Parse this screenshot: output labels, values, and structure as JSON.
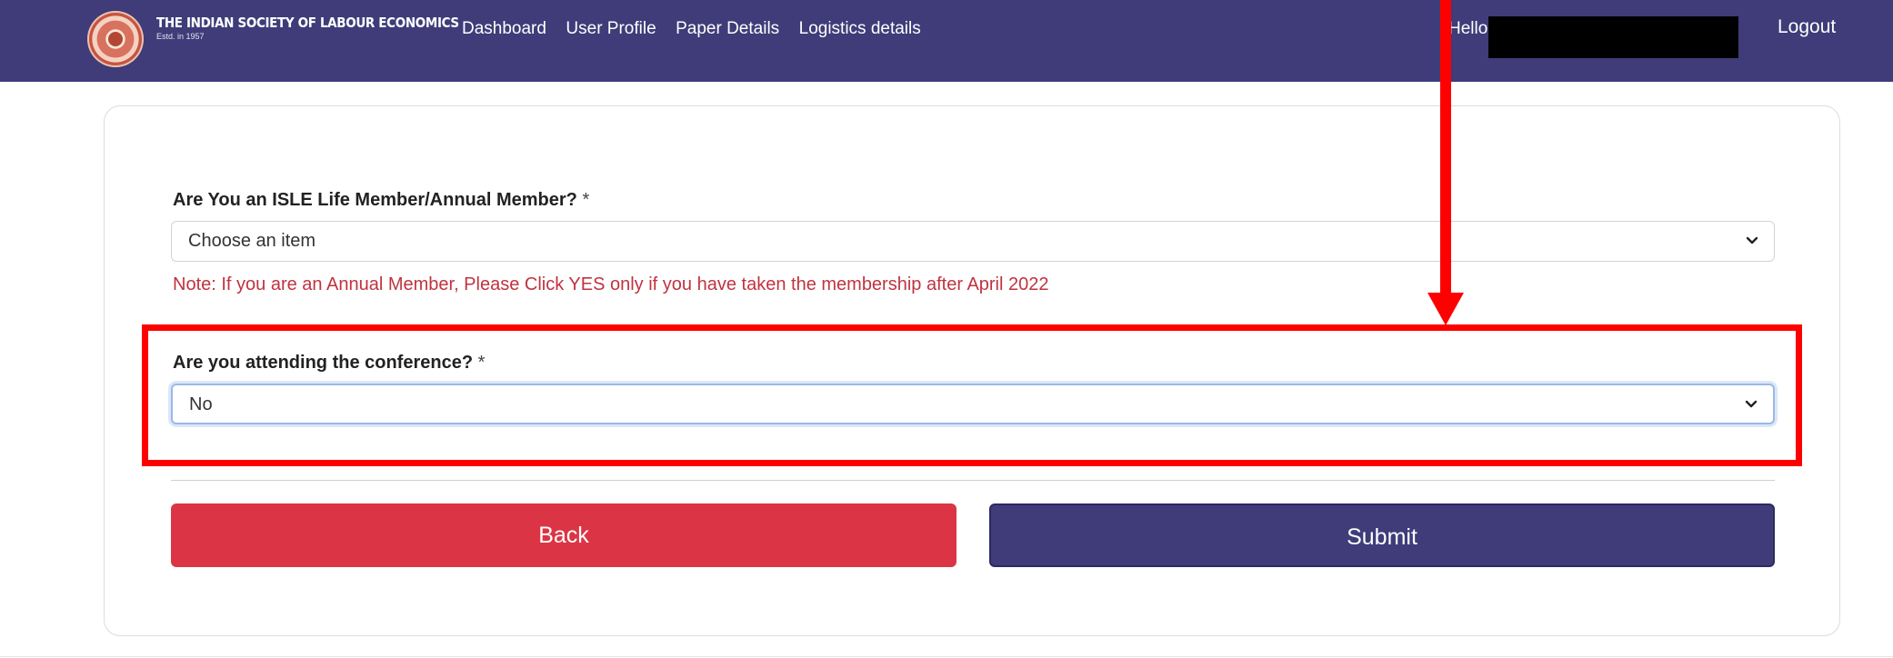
{
  "header": {
    "brand_name": "THE INDIAN SOCIETY OF LABOUR ECONOMICS",
    "brand_est": "Estd. in 1957",
    "nav": [
      "Dashboard",
      "User Profile",
      "Paper Details",
      "Logistics details"
    ],
    "greeting": "Hello",
    "logout": "Logout"
  },
  "form": {
    "membership": {
      "label": "Are You an ISLE Life Member/Annual Member?",
      "required_mark": "*",
      "value": "Choose an item"
    },
    "note": "Note: If you are an Annual Member, Please Click YES only if you have taken the membership after April 2022",
    "attending": {
      "label": "Are you attending the conference?",
      "required_mark": "*",
      "value": "No"
    },
    "back_label": "Back",
    "submit_label": "Submit"
  },
  "colors": {
    "navbar": "#3f3c79",
    "back_button": "#db3545",
    "submit_button": "#3f3c79",
    "note_text": "#c0333f",
    "annotation": "#ff0000"
  }
}
